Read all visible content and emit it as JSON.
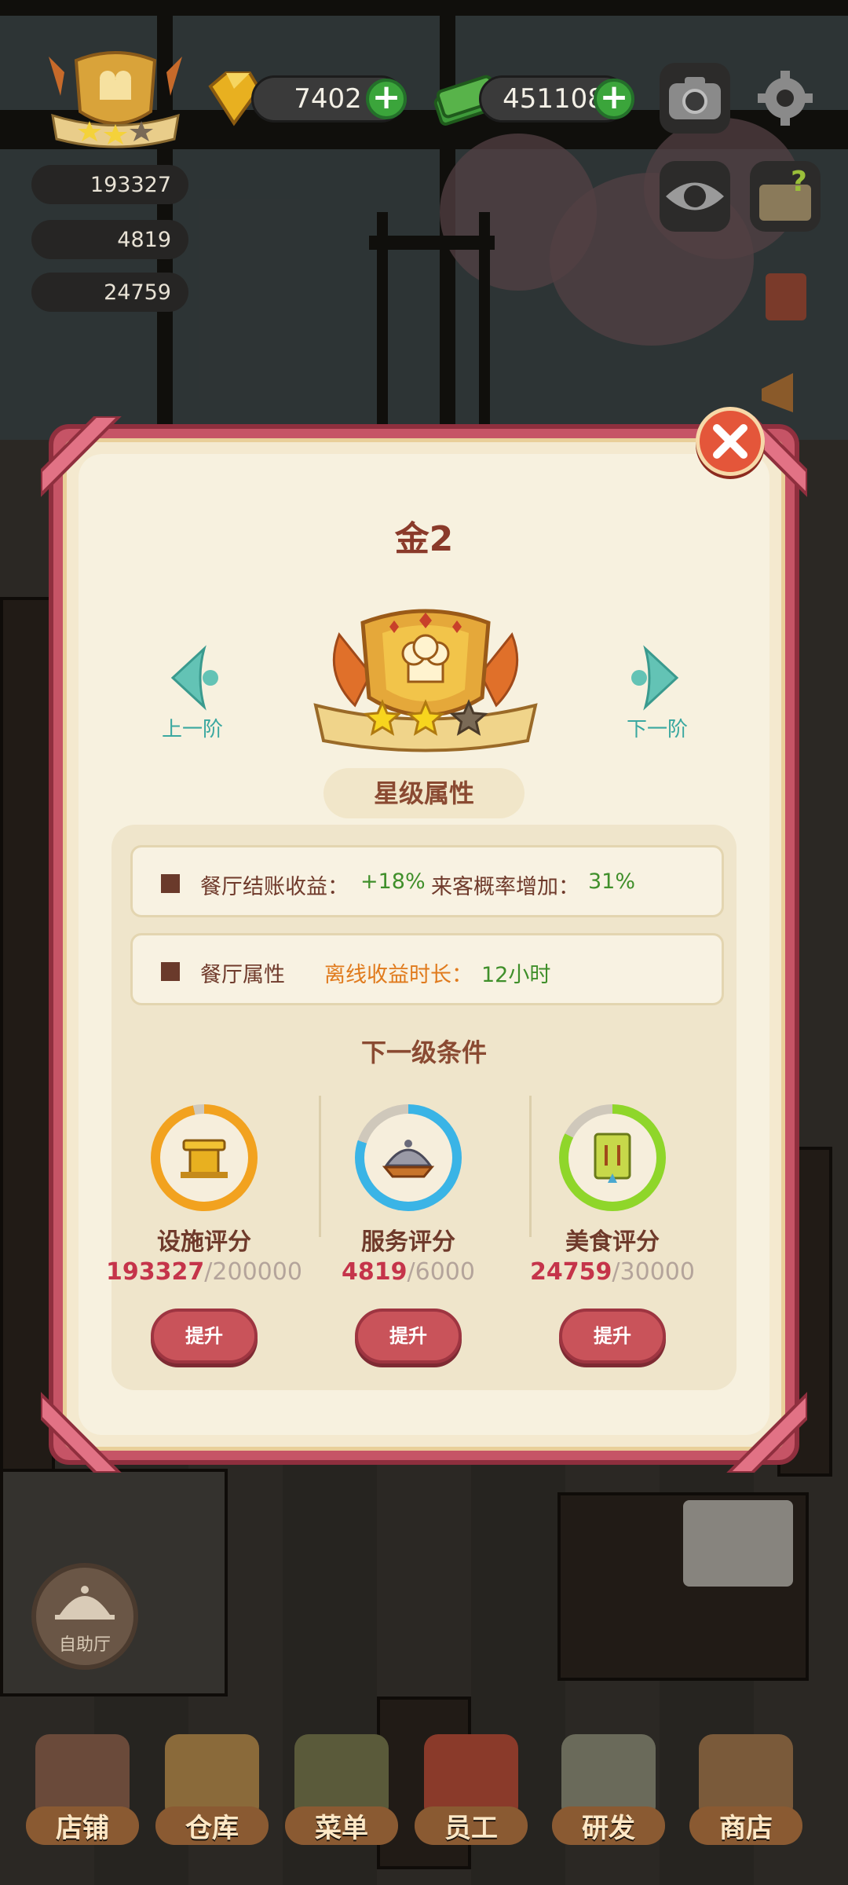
{
  "hud": {
    "diamonds": "7402",
    "cash": "451108",
    "facility_score": "193327",
    "service_score": "4819",
    "food_score": "24759"
  },
  "dialog": {
    "title": "金2",
    "prev_label": "上一阶",
    "next_label": "下一阶",
    "section_title": "星级属性",
    "attr1": {
      "label": "餐厅结账收益：",
      "value": "+18%",
      "label2": "来客概率增加：",
      "value2": "31%"
    },
    "attr2": {
      "label": "餐厅属性",
      "offline_label": "离线收益时长：",
      "offline_value": "12小时"
    },
    "next_level_title": "下一级条件",
    "requirements": [
      {
        "name": "设施评分",
        "current": "193327",
        "separator": "/",
        "max": "200000",
        "progress": 0.967,
        "color": "#f2a21f",
        "button": "提升",
        "icon": "facility-icon"
      },
      {
        "name": "服务评分",
        "current": "4819",
        "separator": "/",
        "max": "6000",
        "progress": 0.803,
        "color": "#3ab4e6",
        "button": "提升",
        "icon": "service-cloche-icon"
      },
      {
        "name": "美食评分",
        "current": "24759",
        "separator": "/",
        "max": "30000",
        "progress": 0.825,
        "color": "#8fd62a",
        "button": "提升",
        "icon": "recipe-book-icon"
      }
    ],
    "stars_filled": 2,
    "stars_total": 3
  },
  "self_service_label": "自助厅",
  "tabs": [
    {
      "label": "店铺",
      "icon": "shop-icon"
    },
    {
      "label": "仓库",
      "icon": "warehouse-icon"
    },
    {
      "label": "菜单",
      "icon": "menu-icon"
    },
    {
      "label": "员工",
      "icon": "staff-icon"
    },
    {
      "label": "研发",
      "icon": "research-icon"
    },
    {
      "label": "商店",
      "icon": "store-icon"
    }
  ]
}
